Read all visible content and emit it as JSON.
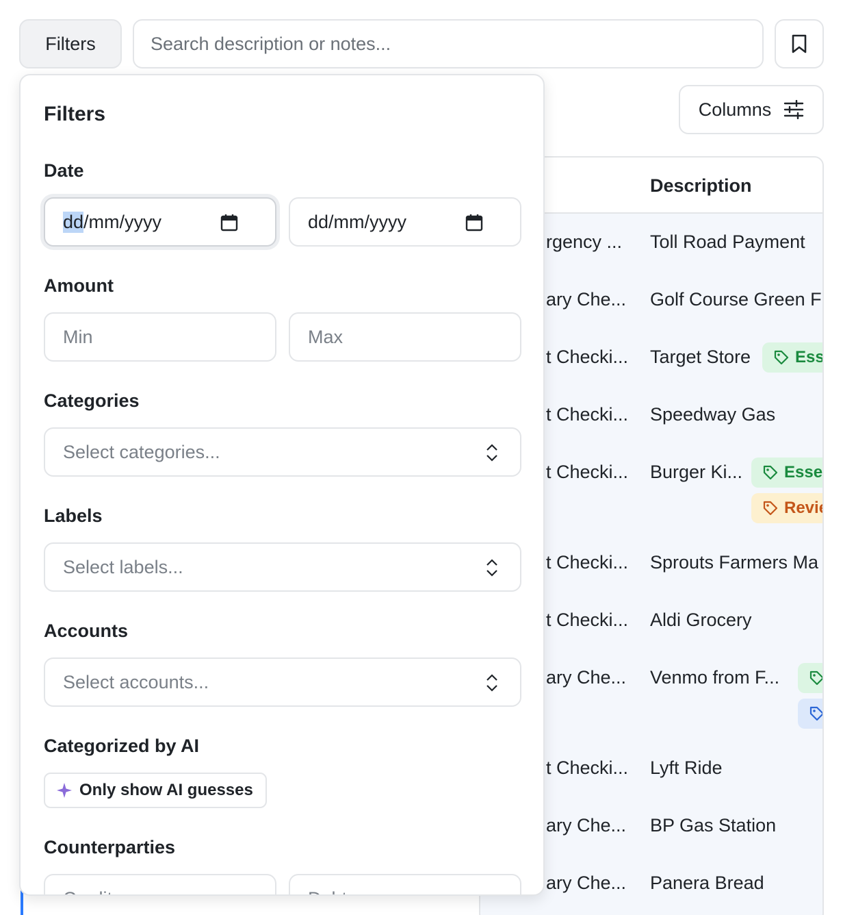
{
  "toolbar": {
    "filters_label": "Filters",
    "search_placeholder": "Search description or notes...",
    "columns_label": "Columns"
  },
  "table": {
    "description_header": "Description",
    "rows": [
      {
        "account": "rgency ...",
        "description": "Toll Road Payment",
        "tags": []
      },
      {
        "account": "ary Che...",
        "description": "Golf Course Green F",
        "tags": []
      },
      {
        "account": "t Checki...",
        "description": "Target Store",
        "tags": [
          {
            "label": "Ess",
            "color": "green"
          }
        ]
      },
      {
        "account": "t Checki...",
        "description": "Speedway Gas",
        "tags": []
      },
      {
        "account": "t Checki...",
        "description": "Burger Ki...",
        "tags": [
          {
            "label": "Essen",
            "color": "green"
          },
          {
            "label": "Revie",
            "color": "yellow"
          }
        ]
      },
      {
        "account": "t Checki...",
        "description": "Sprouts Farmers Ma",
        "tags": []
      },
      {
        "account": "t Checki...",
        "description": "Aldi Grocery",
        "tags": []
      },
      {
        "account": "ary Che...",
        "description": "Venmo from F...",
        "tags": [
          {
            "label": "",
            "color": "green"
          },
          {
            "label": "",
            "color": "blue"
          }
        ]
      },
      {
        "account": "t Checki...",
        "description": "Lyft Ride",
        "tags": []
      },
      {
        "account": "ary Che...",
        "description": "BP Gas Station",
        "tags": []
      },
      {
        "account": "ary Che...",
        "description": "Panera Bread",
        "tags": []
      }
    ]
  },
  "filters_panel": {
    "title": "Filters",
    "date": {
      "label": "Date",
      "from_dd": "dd",
      "from_rest": "/mm/yyyy",
      "to_value": "dd/mm/yyyy"
    },
    "amount": {
      "label": "Amount",
      "min_placeholder": "Min",
      "max_placeholder": "Max"
    },
    "categories": {
      "label": "Categories",
      "placeholder": "Select categories..."
    },
    "labels": {
      "label": "Labels",
      "placeholder": "Select labels..."
    },
    "accounts": {
      "label": "Accounts",
      "placeholder": "Select accounts..."
    },
    "ai": {
      "label": "Categorized by AI",
      "toggle_label": "Only show AI guesses"
    },
    "counterparties": {
      "label": "Counterparties",
      "creditor_placeholder": "Creditor name",
      "debtor_placeholder": "Debtor name"
    }
  },
  "colors": {
    "tag_green_bg": "#dcf5e3",
    "tag_green_fg": "#1a8a3e",
    "tag_yellow_bg": "#fdf0cf",
    "tag_yellow_fg": "#c4561a",
    "tag_blue_bg": "#dce8fb",
    "tag_blue_fg": "#2b66d6",
    "selection_accent": "#2b7bff"
  }
}
